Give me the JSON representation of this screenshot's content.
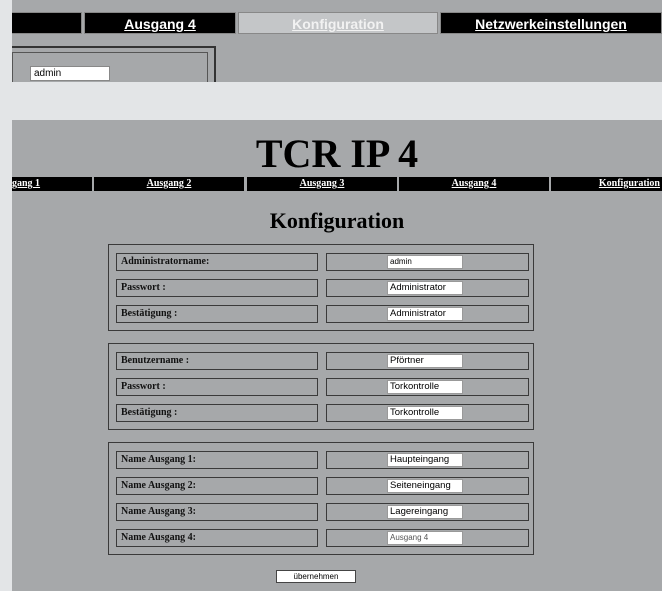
{
  "top_screenshot": {
    "tabs": [
      {
        "label": "Ausgang 4"
      },
      {
        "label": "Konfiguration"
      },
      {
        "label": "Netzwerkeinstellungen"
      }
    ],
    "admin_value": "admin"
  },
  "main_screenshot": {
    "site_title": "TCR IP 4",
    "nav": [
      {
        "label": "gang 1"
      },
      {
        "label": "Ausgang 2"
      },
      {
        "label": "Ausgang 3"
      },
      {
        "label": "Ausgang 4"
      },
      {
        "label": "Konfiguration"
      }
    ],
    "heading": "Konfiguration",
    "groups": [
      {
        "rows": [
          {
            "label": "Administratorname:",
            "value": "admin"
          },
          {
            "label": "Passwort :",
            "value": "Administrator"
          },
          {
            "label": "Bestätigung :",
            "value": "Administrator"
          }
        ]
      },
      {
        "rows": [
          {
            "label": "Benutzername :",
            "value": "Pförtner"
          },
          {
            "label": "Passwort :",
            "value": "Torkontrolle"
          },
          {
            "label": "Bestätigung :",
            "value": "Torkontrolle"
          }
        ]
      },
      {
        "rows": [
          {
            "label": "Name Ausgang 1:",
            "value": "Haupteingang"
          },
          {
            "label": "Name Ausgang 2:",
            "value": "Seiteneingang"
          },
          {
            "label": "Name Ausgang 3:",
            "value": "Lagereingang"
          },
          {
            "label": "Name Ausgang 4:",
            "value": "Ausgang 4"
          }
        ]
      }
    ],
    "submit_label": "übernehmen"
  }
}
